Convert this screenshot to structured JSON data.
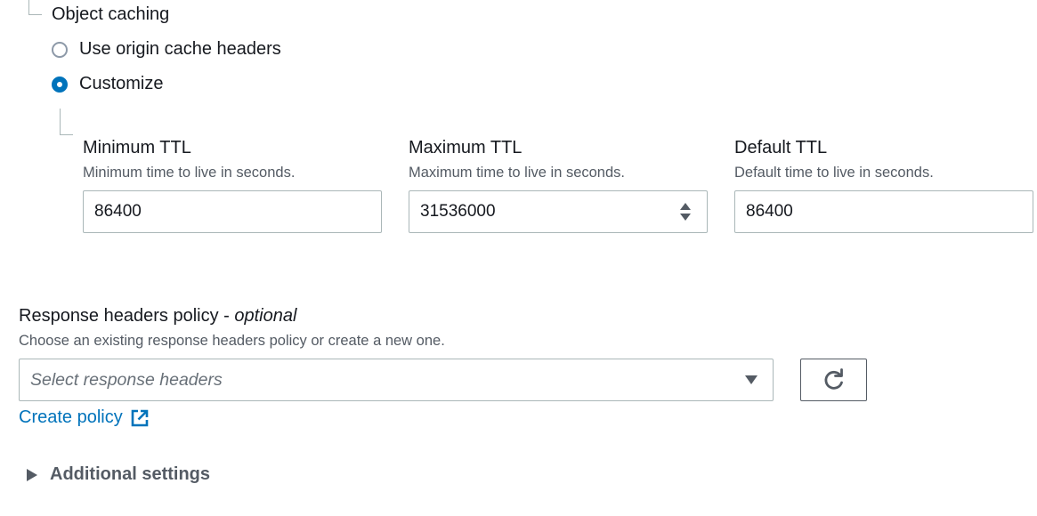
{
  "object_caching": {
    "label": "Object caching",
    "options": [
      {
        "label": "Use origin cache headers",
        "selected": false
      },
      {
        "label": "Customize",
        "selected": true
      }
    ]
  },
  "ttl_fields": {
    "minimum": {
      "label": "Minimum TTL",
      "description": "Minimum time to live in seconds.",
      "value": "86400"
    },
    "maximum": {
      "label": "Maximum TTL",
      "description": "Maximum time to live in seconds.",
      "value": "31536000"
    },
    "default": {
      "label": "Default TTL",
      "description": "Default time to live in seconds.",
      "value": "86400"
    }
  },
  "response_headers_policy": {
    "label": "Response headers policy - ",
    "optional": "optional",
    "description": "Choose an existing response headers policy or create a new one.",
    "placeholder": "Select response headers",
    "refresh_icon": "refresh-icon",
    "create_link": "Create policy",
    "create_link_icon": "external-link-icon"
  },
  "additional_settings": {
    "label": "Additional settings",
    "icon": "caret-right-icon"
  },
  "colors": {
    "accent": "#0073bb",
    "text": "#16191f",
    "secondary_text": "#545b64",
    "border": "#aab7b8"
  }
}
